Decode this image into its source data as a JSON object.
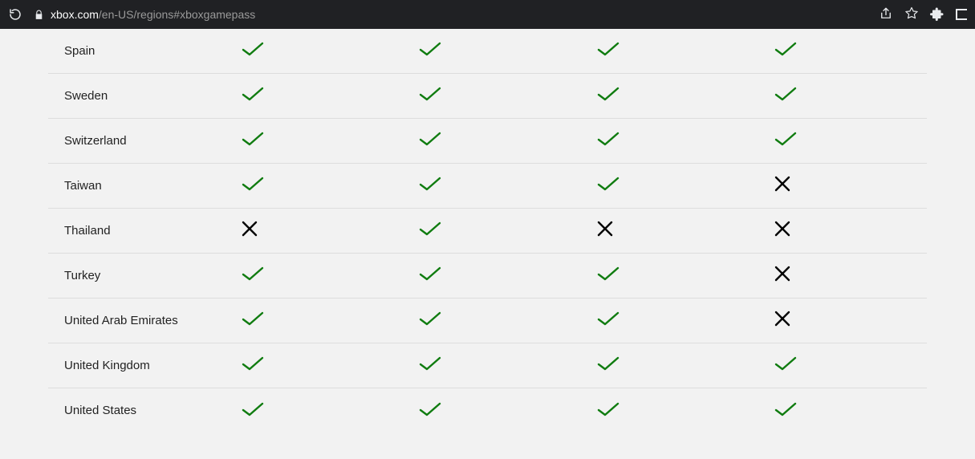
{
  "browser": {
    "url_host": "xbox.com",
    "url_path": "/en-US/regions#xboxgamepass"
  },
  "table": {
    "rows": [
      {
        "name": "Spain",
        "cols": [
          true,
          true,
          true,
          true
        ]
      },
      {
        "name": "Sweden",
        "cols": [
          true,
          true,
          true,
          true
        ]
      },
      {
        "name": "Switzerland",
        "cols": [
          true,
          true,
          true,
          true
        ]
      },
      {
        "name": "Taiwan",
        "cols": [
          true,
          true,
          true,
          false
        ]
      },
      {
        "name": "Thailand",
        "cols": [
          false,
          true,
          false,
          false
        ]
      },
      {
        "name": "Turkey",
        "cols": [
          true,
          true,
          true,
          false
        ]
      },
      {
        "name": "United Arab Emirates",
        "cols": [
          true,
          true,
          true,
          false
        ]
      },
      {
        "name": "United Kingdom",
        "cols": [
          true,
          true,
          true,
          true
        ]
      },
      {
        "name": "United States",
        "cols": [
          true,
          true,
          true,
          true
        ]
      }
    ]
  }
}
